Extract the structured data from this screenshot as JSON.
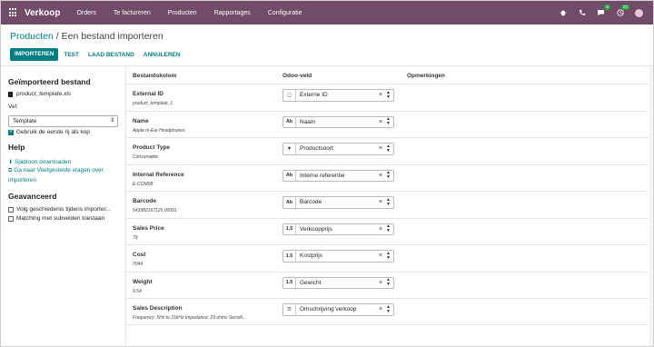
{
  "navbar": {
    "brand": "Verkoop",
    "menu": [
      "Orders",
      "Te factureren",
      "Producten",
      "Rapportages",
      "Configuratie"
    ],
    "messages_count": "5",
    "activities_count": "22"
  },
  "breadcrumb": {
    "parent": "Producten",
    "separator": "/",
    "current": "Een bestand importeren"
  },
  "buttons": {
    "import": "IMPORTEREN",
    "test": "TEST",
    "load_file": "LAAD BESTAND",
    "cancel": "ANNULEREN"
  },
  "sidebar": {
    "imported_title": "Geïmporteerd bestand",
    "file_name": "product_template.xls",
    "tab_label": "Vel:",
    "tab_value": "Template",
    "first_row_header": "Gebruik de eerste rij als kop",
    "help_title": "Help",
    "download_template": "Sjabloon downloaden",
    "faq": "Ga naar Veelgestelde vragen over importeren",
    "advanced_title": "Geavanceerd",
    "track_history": "Volg geschiedenis tijdens importer...",
    "match_subfields": "Matching met subvelden toestaan"
  },
  "table": {
    "headers": {
      "column": "Bestandskolom",
      "odoo_field": "Odoo-veld",
      "comments": "Opmerkingen"
    },
    "rows": [
      {
        "name": "External ID",
        "sample": "product_template_1",
        "icon": "◻",
        "field": "Externe ID"
      },
      {
        "name": "Name",
        "sample": "Apple In-Ear Headphones",
        "icon": "Ab",
        "field": "Naam"
      },
      {
        "name": "Product Type",
        "sample": "Consumable",
        "icon": "▼",
        "field": "Productsoort"
      },
      {
        "name": "Internal Reference",
        "sample": "E-COM08",
        "icon": "Ab",
        "field": "Interne referentie"
      },
      {
        "name": "Barcode",
        "sample": "543982167125.00001",
        "icon": "Ab",
        "field": "Barcode"
      },
      {
        "name": "Sales Price",
        "sample": "79",
        "icon": "1.5",
        "field": "Verkoopprijs"
      },
      {
        "name": "Cost",
        "sample": "7044",
        "icon": "1.5",
        "field": "Kostprijs"
      },
      {
        "name": "Weight",
        "sample": "9.54",
        "icon": "1.5",
        "field": "Gewicht"
      },
      {
        "name": "Sales Description",
        "sample": "Frequency: 5Hz to 21kHz Impedance: 23 ohms Sensiti...",
        "icon": "☰",
        "field": "Omschrijving verkoop"
      }
    ]
  }
}
